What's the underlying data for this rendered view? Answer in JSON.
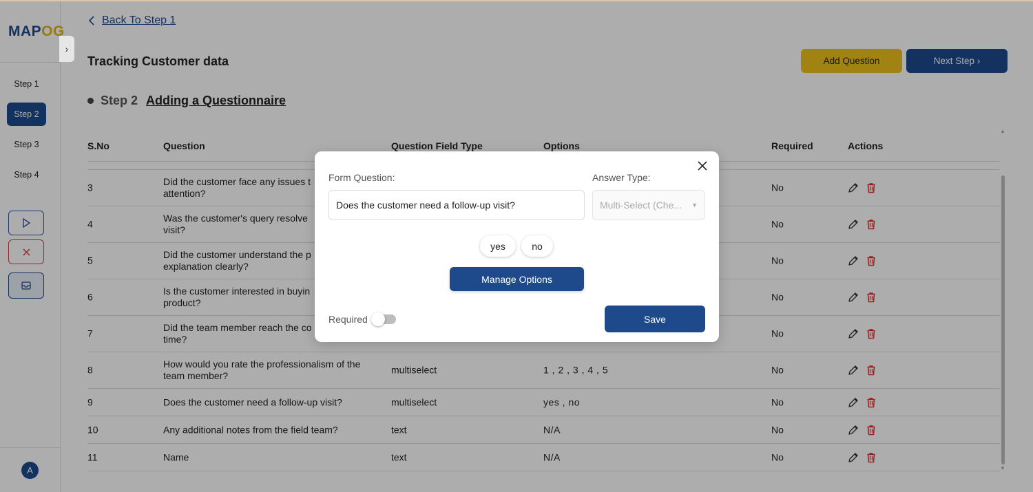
{
  "sidebar": {
    "logo_main": "MAP",
    "logo_accent": "OG",
    "steps": [
      "Step 1",
      "Step 2",
      "Step 3",
      "Step 4"
    ],
    "active_step": 1,
    "avatar_initial": "A"
  },
  "header": {
    "back_label": "Back To Step 1",
    "page_title": "Tracking Customer data",
    "add_question_label": "Add Question",
    "next_step_label": "Next Step"
  },
  "step_heading": {
    "number": "Step 2",
    "title": "Adding a Questionnaire"
  },
  "table": {
    "columns": [
      "S.No",
      "Question",
      "Question Field Type",
      "Options",
      "Required",
      "Actions"
    ],
    "rows": [
      {
        "sno": "3",
        "question": "Did the customer face any issues t\nattention?",
        "type": "",
        "options": "",
        "required": "No"
      },
      {
        "sno": "4",
        "question": "Was the customer's query resolve\nvisit?",
        "type": "",
        "options": "",
        "required": "No"
      },
      {
        "sno": "5",
        "question": "Did the customer understand the p\nexplanation clearly?",
        "type": "",
        "options": "",
        "required": "No"
      },
      {
        "sno": "6",
        "question": "Is the customer interested in buyin\nproduct?",
        "type": "",
        "options": "",
        "required": "No"
      },
      {
        "sno": "7",
        "question": "Did the team member reach the co\ntime?",
        "type": "",
        "options": "",
        "required": "No"
      },
      {
        "sno": "8",
        "question": "How would you rate the professionalism of the\nteam member?",
        "type": "multiselect",
        "options": "1 , 2 , 3 , 4 , 5",
        "required": "No"
      },
      {
        "sno": "9",
        "question": "Does the customer need a follow-up visit?",
        "type": "multiselect",
        "options": "yes , no",
        "required": "No"
      },
      {
        "sno": "10",
        "question": "Any additional notes from the field team?",
        "type": "text",
        "options": "N/A",
        "required": "No"
      },
      {
        "sno": "11",
        "question": "Name",
        "type": "text",
        "options": "N/A",
        "required": "No"
      }
    ]
  },
  "modal": {
    "form_question_label": "Form Question:",
    "form_question_value": "Does the customer need a follow-up visit?",
    "answer_type_label": "Answer Type:",
    "answer_type_value": "Multi-Select (Che...",
    "options": [
      "yes",
      "no"
    ],
    "manage_options_label": "Manage Options",
    "required_label": "Required",
    "required_on": false,
    "save_label": "Save"
  },
  "colors": {
    "primary": "#1e4a8c",
    "accent": "#eec21c",
    "danger": "#d63b3b"
  }
}
